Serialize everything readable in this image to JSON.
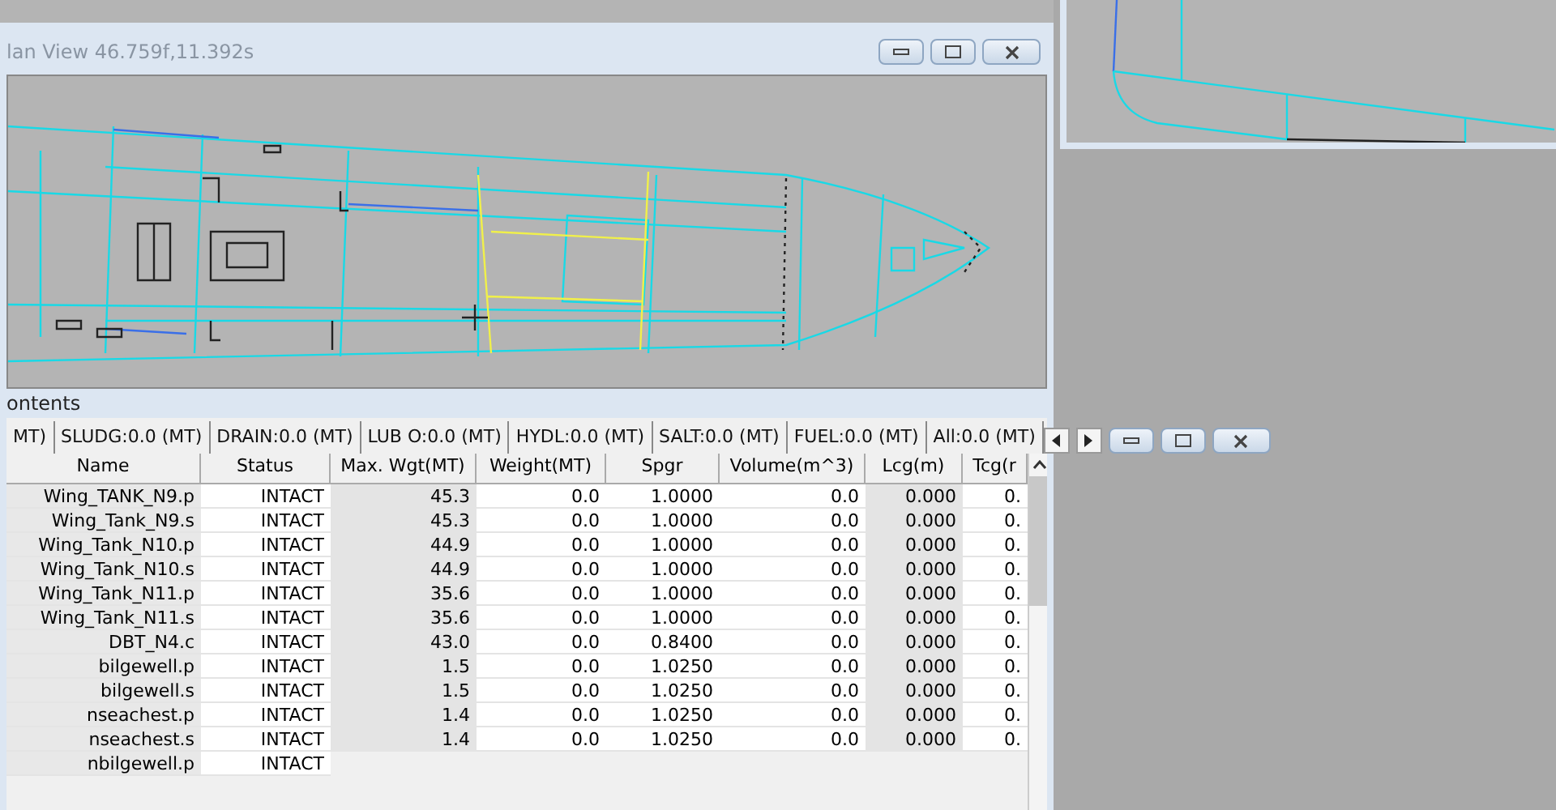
{
  "plan_view": {
    "title": "lan View 46.759f,11.392s"
  },
  "contents": {
    "title": "ontents",
    "tabs": [
      "MT)",
      "SLUDG:0.0 (MT)",
      "DRAIN:0.0 (MT)",
      "LUB O:0.0 (MT)",
      "HYDL:0.0 (MT)",
      "SALT:0.0 (MT)",
      "FUEL:0.0 (MT)",
      "All:0.0 (MT)"
    ],
    "table": {
      "columns": [
        "Name",
        "Status",
        "Max. Wgt(MT)",
        "Weight(MT)",
        "Spgr",
        "Volume(m^3)",
        "Lcg(m)",
        "Tcg(r"
      ],
      "rows": [
        [
          "Wing_TANK_N9.p",
          "INTACT",
          "45.3",
          "0.0",
          "1.0000",
          "0.0",
          "0.000",
          "0."
        ],
        [
          "Wing_Tank_N9.s",
          "INTACT",
          "45.3",
          "0.0",
          "1.0000",
          "0.0",
          "0.000",
          "0."
        ],
        [
          "Wing_Tank_N10.p",
          "INTACT",
          "44.9",
          "0.0",
          "1.0000",
          "0.0",
          "0.000",
          "0."
        ],
        [
          "Wing_Tank_N10.s",
          "INTACT",
          "44.9",
          "0.0",
          "1.0000",
          "0.0",
          "0.000",
          "0."
        ],
        [
          "Wing_Tank_N11.p",
          "INTACT",
          "35.6",
          "0.0",
          "1.0000",
          "0.0",
          "0.000",
          "0."
        ],
        [
          "Wing_Tank_N11.s",
          "INTACT",
          "35.6",
          "0.0",
          "1.0000",
          "0.0",
          "0.000",
          "0."
        ],
        [
          "DBT_N4.c",
          "INTACT",
          "43.0",
          "0.0",
          "0.8400",
          "0.0",
          "0.000",
          "0."
        ],
        [
          "bilgewell.p",
          "INTACT",
          "1.5",
          "0.0",
          "1.0250",
          "0.0",
          "0.000",
          "0."
        ],
        [
          "bilgewell.s",
          "INTACT",
          "1.5",
          "0.0",
          "1.0250",
          "0.0",
          "0.000",
          "0."
        ],
        [
          "nseachest.p",
          "INTACT",
          "1.4",
          "0.0",
          "1.0250",
          "0.0",
          "0.000",
          "0."
        ],
        [
          "nseachest.s",
          "INTACT",
          "1.4",
          "0.0",
          "1.0250",
          "0.0",
          "0.000",
          "0."
        ],
        [
          "nbilgewell.p",
          "INTACT"
        ]
      ]
    }
  }
}
